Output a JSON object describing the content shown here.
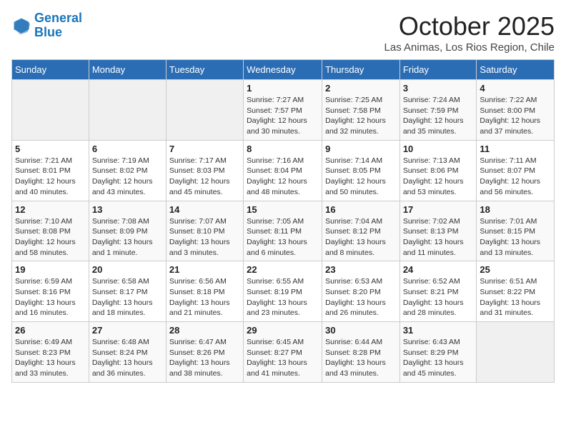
{
  "header": {
    "logo_line1": "General",
    "logo_line2": "Blue",
    "month": "October 2025",
    "location": "Las Animas, Los Rios Region, Chile"
  },
  "weekdays": [
    "Sunday",
    "Monday",
    "Tuesday",
    "Wednesday",
    "Thursday",
    "Friday",
    "Saturday"
  ],
  "weeks": [
    [
      {
        "day": "",
        "info": ""
      },
      {
        "day": "",
        "info": ""
      },
      {
        "day": "",
        "info": ""
      },
      {
        "day": "1",
        "info": "Sunrise: 7:27 AM\nSunset: 7:57 PM\nDaylight: 12 hours and 30 minutes."
      },
      {
        "day": "2",
        "info": "Sunrise: 7:25 AM\nSunset: 7:58 PM\nDaylight: 12 hours and 32 minutes."
      },
      {
        "day": "3",
        "info": "Sunrise: 7:24 AM\nSunset: 7:59 PM\nDaylight: 12 hours and 35 minutes."
      },
      {
        "day": "4",
        "info": "Sunrise: 7:22 AM\nSunset: 8:00 PM\nDaylight: 12 hours and 37 minutes."
      }
    ],
    [
      {
        "day": "5",
        "info": "Sunrise: 7:21 AM\nSunset: 8:01 PM\nDaylight: 12 hours and 40 minutes."
      },
      {
        "day": "6",
        "info": "Sunrise: 7:19 AM\nSunset: 8:02 PM\nDaylight: 12 hours and 43 minutes."
      },
      {
        "day": "7",
        "info": "Sunrise: 7:17 AM\nSunset: 8:03 PM\nDaylight: 12 hours and 45 minutes."
      },
      {
        "day": "8",
        "info": "Sunrise: 7:16 AM\nSunset: 8:04 PM\nDaylight: 12 hours and 48 minutes."
      },
      {
        "day": "9",
        "info": "Sunrise: 7:14 AM\nSunset: 8:05 PM\nDaylight: 12 hours and 50 minutes."
      },
      {
        "day": "10",
        "info": "Sunrise: 7:13 AM\nSunset: 8:06 PM\nDaylight: 12 hours and 53 minutes."
      },
      {
        "day": "11",
        "info": "Sunrise: 7:11 AM\nSunset: 8:07 PM\nDaylight: 12 hours and 56 minutes."
      }
    ],
    [
      {
        "day": "12",
        "info": "Sunrise: 7:10 AM\nSunset: 8:08 PM\nDaylight: 12 hours and 58 minutes."
      },
      {
        "day": "13",
        "info": "Sunrise: 7:08 AM\nSunset: 8:09 PM\nDaylight: 13 hours and 1 minute."
      },
      {
        "day": "14",
        "info": "Sunrise: 7:07 AM\nSunset: 8:10 PM\nDaylight: 13 hours and 3 minutes."
      },
      {
        "day": "15",
        "info": "Sunrise: 7:05 AM\nSunset: 8:11 PM\nDaylight: 13 hours and 6 minutes."
      },
      {
        "day": "16",
        "info": "Sunrise: 7:04 AM\nSunset: 8:12 PM\nDaylight: 13 hours and 8 minutes."
      },
      {
        "day": "17",
        "info": "Sunrise: 7:02 AM\nSunset: 8:13 PM\nDaylight: 13 hours and 11 minutes."
      },
      {
        "day": "18",
        "info": "Sunrise: 7:01 AM\nSunset: 8:15 PM\nDaylight: 13 hours and 13 minutes."
      }
    ],
    [
      {
        "day": "19",
        "info": "Sunrise: 6:59 AM\nSunset: 8:16 PM\nDaylight: 13 hours and 16 minutes."
      },
      {
        "day": "20",
        "info": "Sunrise: 6:58 AM\nSunset: 8:17 PM\nDaylight: 13 hours and 18 minutes."
      },
      {
        "day": "21",
        "info": "Sunrise: 6:56 AM\nSunset: 8:18 PM\nDaylight: 13 hours and 21 minutes."
      },
      {
        "day": "22",
        "info": "Sunrise: 6:55 AM\nSunset: 8:19 PM\nDaylight: 13 hours and 23 minutes."
      },
      {
        "day": "23",
        "info": "Sunrise: 6:53 AM\nSunset: 8:20 PM\nDaylight: 13 hours and 26 minutes."
      },
      {
        "day": "24",
        "info": "Sunrise: 6:52 AM\nSunset: 8:21 PM\nDaylight: 13 hours and 28 minutes."
      },
      {
        "day": "25",
        "info": "Sunrise: 6:51 AM\nSunset: 8:22 PM\nDaylight: 13 hours and 31 minutes."
      }
    ],
    [
      {
        "day": "26",
        "info": "Sunrise: 6:49 AM\nSunset: 8:23 PM\nDaylight: 13 hours and 33 minutes."
      },
      {
        "day": "27",
        "info": "Sunrise: 6:48 AM\nSunset: 8:24 PM\nDaylight: 13 hours and 36 minutes."
      },
      {
        "day": "28",
        "info": "Sunrise: 6:47 AM\nSunset: 8:26 PM\nDaylight: 13 hours and 38 minutes."
      },
      {
        "day": "29",
        "info": "Sunrise: 6:45 AM\nSunset: 8:27 PM\nDaylight: 13 hours and 41 minutes."
      },
      {
        "day": "30",
        "info": "Sunrise: 6:44 AM\nSunset: 8:28 PM\nDaylight: 13 hours and 43 minutes."
      },
      {
        "day": "31",
        "info": "Sunrise: 6:43 AM\nSunset: 8:29 PM\nDaylight: 13 hours and 45 minutes."
      },
      {
        "day": "",
        "info": ""
      }
    ]
  ]
}
